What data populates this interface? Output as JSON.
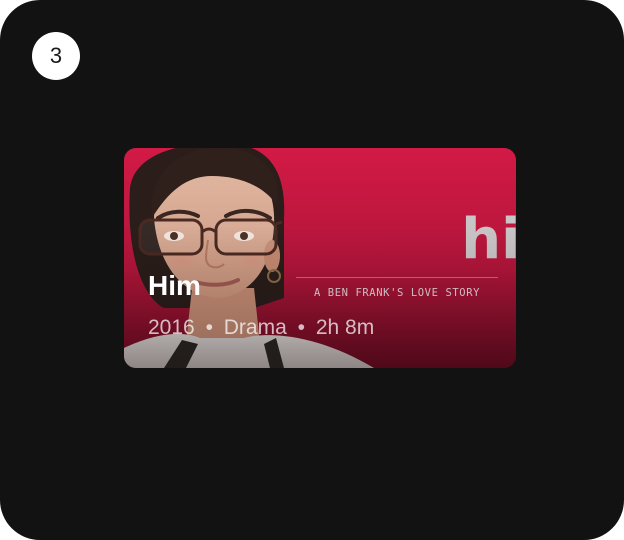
{
  "step": {
    "number": "3"
  },
  "card": {
    "title": "Him",
    "meta": {
      "year": "2016",
      "genre": "Drama",
      "runtime": "2h 8m",
      "separator": "•"
    },
    "poster": {
      "title": "him",
      "tagline": "A BEN FRANK'S LOVE STORY"
    }
  },
  "colors": {
    "background": "#121212",
    "card_top": "#d21a46",
    "card_bottom": "#6a0c22"
  }
}
